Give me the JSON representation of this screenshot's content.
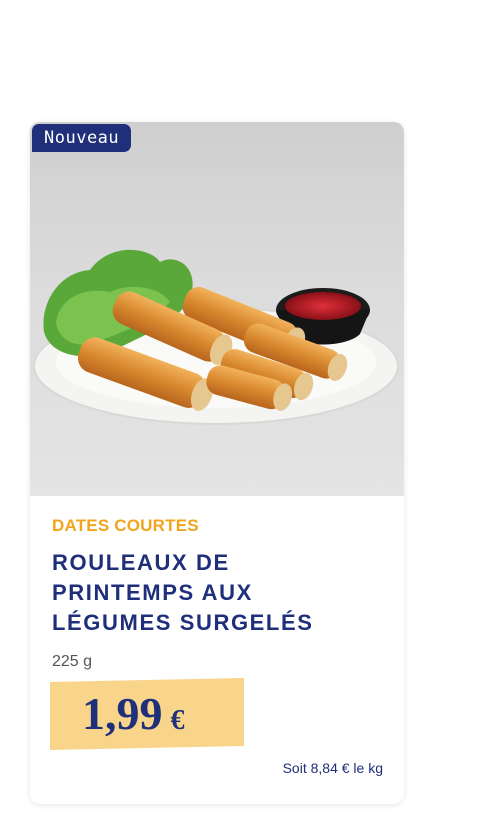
{
  "badge": "Nouveau",
  "product": {
    "tag": "DATES COURTES",
    "title_lines": [
      "ROULEAUX DE",
      "PRINTEMPS AUX",
      "LÉGUMES SURGELÉS"
    ],
    "weight": "225 g",
    "price": "1,99",
    "currency": "€",
    "unit_price": "Soit 8,84 € le kg"
  },
  "colors": {
    "brand_navy": "#1f2f7a",
    "tag_orange": "#f0a51c",
    "price_highlight": "#f8d58a"
  }
}
